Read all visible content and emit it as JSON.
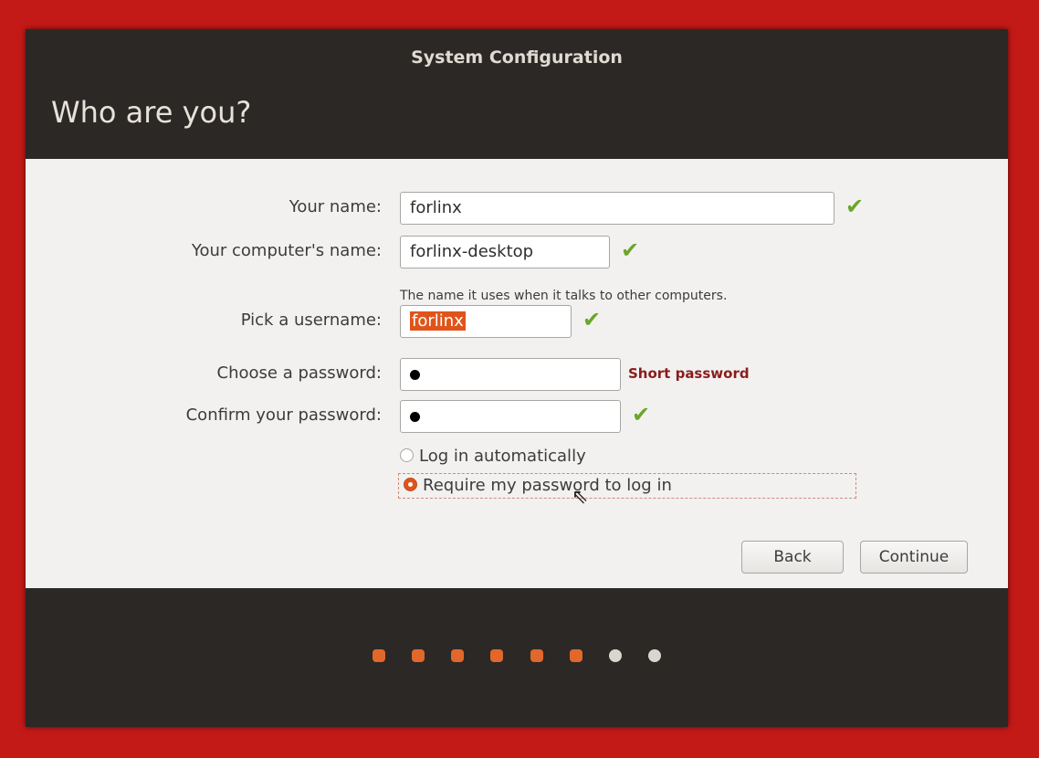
{
  "window": {
    "title": "System Configuration",
    "heading": "Who are you?"
  },
  "form": {
    "name": {
      "label": "Your name:",
      "value": "forlinx",
      "valid": true
    },
    "computer_name": {
      "label": "Your computer's name:",
      "value": "forlinx-desktop",
      "hint": "The name it uses when it talks to other computers.",
      "valid": true
    },
    "username": {
      "label": "Pick a username:",
      "value": "forlinx",
      "valid": true
    },
    "password": {
      "label": "Choose a password:",
      "strength": "Short password"
    },
    "confirm_password": {
      "label": "Confirm your password:",
      "valid": true
    },
    "login_options": [
      {
        "label": "Log in automatically",
        "selected": false
      },
      {
        "label": "Require my password to log in",
        "selected": true
      }
    ]
  },
  "buttons": {
    "back": "Back",
    "continue": "Continue"
  },
  "progress": {
    "completed_steps": 6,
    "total_steps": 8
  },
  "colors": {
    "accent": "#e2672b",
    "valid_check": "#6aa62a",
    "warning_text": "#8a1c1c",
    "background": "#c41a17"
  },
  "icons": {
    "valid": "checkmark-icon",
    "cursor": "mouse-pointer-icon"
  }
}
